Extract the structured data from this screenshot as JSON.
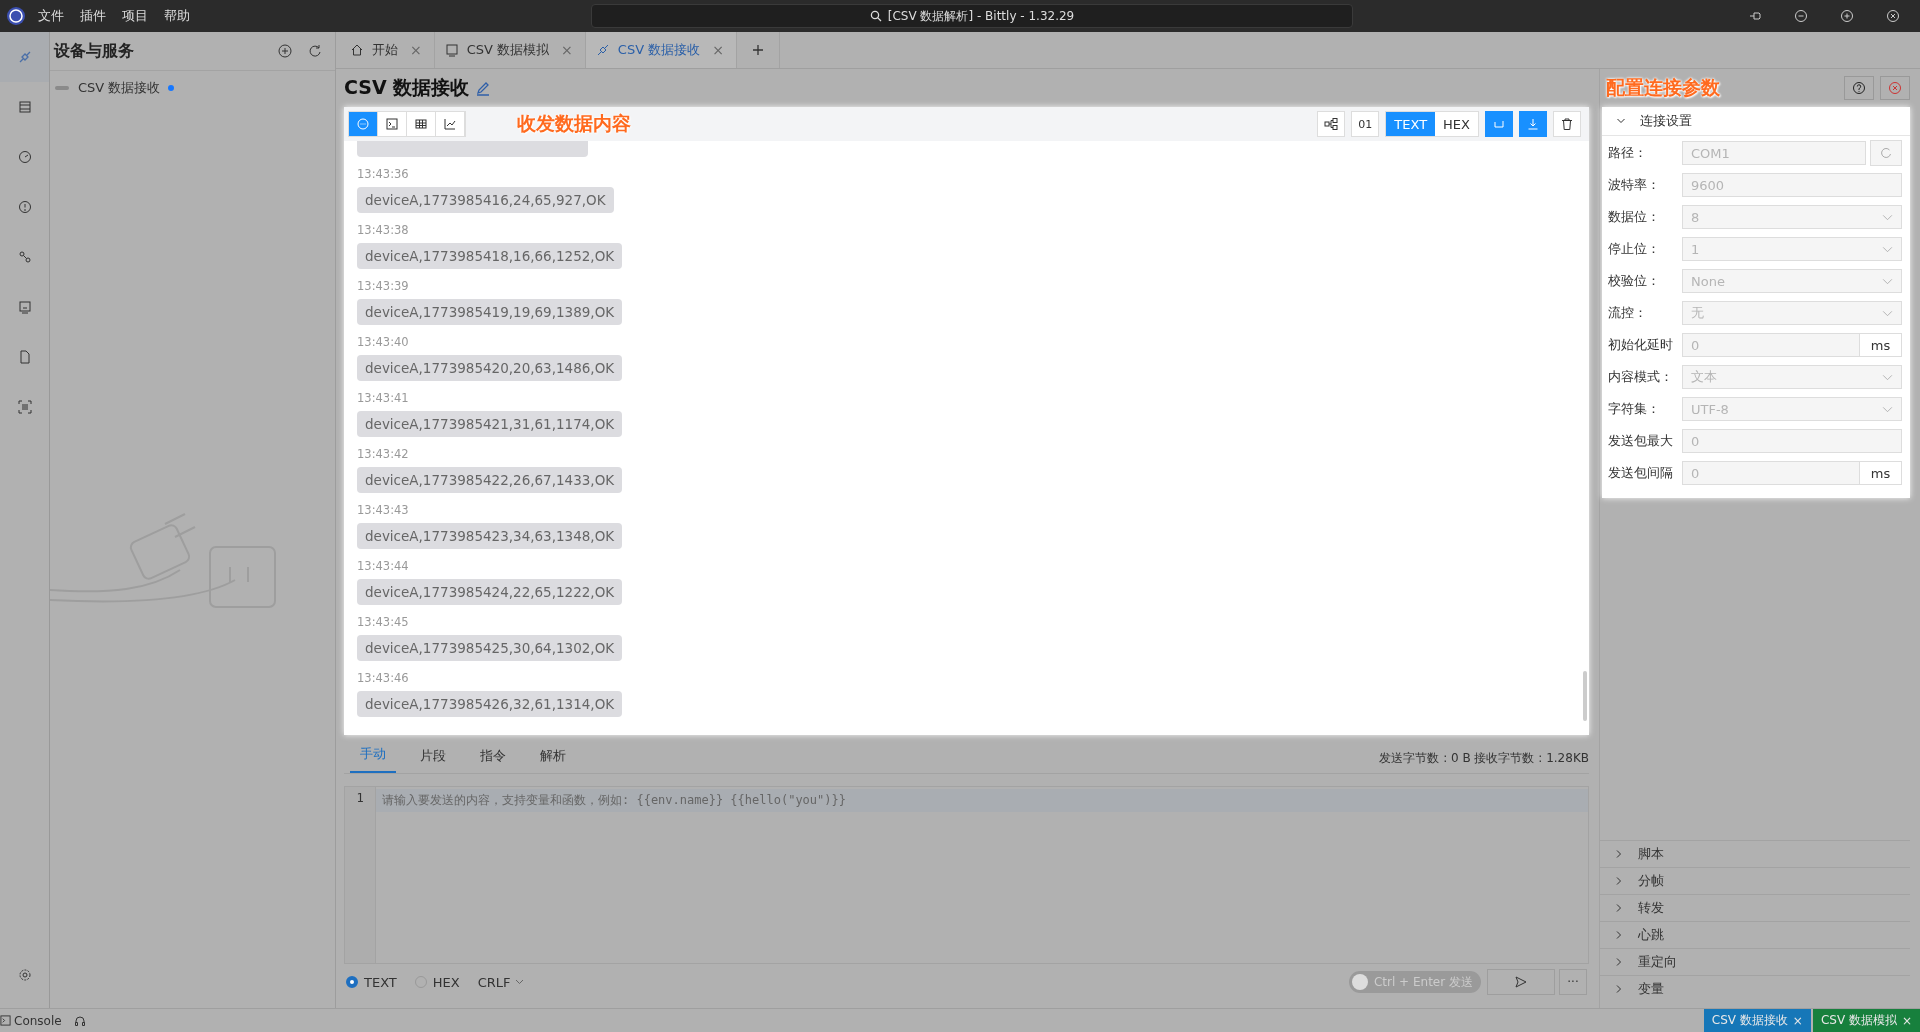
{
  "menu": [
    "文件",
    "插件",
    "项目",
    "帮助"
  ],
  "window": {
    "title": "[CSV 数据解析] - Bittly - 1.32.29"
  },
  "sidebar": {
    "title": "设备与服务",
    "items": [
      {
        "label": "CSV 数据接收",
        "active": true
      }
    ]
  },
  "tabs": [
    {
      "label": "开始",
      "kind": "home",
      "selected": false,
      "close": "×"
    },
    {
      "label": "CSV 数据模拟",
      "kind": "device",
      "selected": false,
      "close": "×"
    },
    {
      "label": "CSV 数据接收",
      "kind": "link",
      "selected": true,
      "close": "×"
    }
  ],
  "page_title": "CSV 数据接收",
  "annotations": [
    "收发数据内容",
    "配置连接参数"
  ],
  "view_buttons": [
    {
      "kind": "chat",
      "selected": true
    },
    {
      "kind": "terminal",
      "selected": false
    },
    {
      "kind": "table",
      "selected": false
    },
    {
      "kind": "chart",
      "selected": false
    }
  ],
  "toolbar": {
    "binary_label": "01",
    "modes": [
      {
        "label": "TEXT",
        "selected": true
      },
      {
        "label": "HEX",
        "selected": false
      }
    ],
    "wrap_on": true,
    "autoscroll_on": true
  },
  "messages": [
    {
      "time": "13:43:36",
      "text": "deviceA,1773985416,24,65,927,OK"
    },
    {
      "time": "13:43:38",
      "text": "deviceA,1773985418,16,66,1252,OK"
    },
    {
      "time": "13:43:39",
      "text": "deviceA,1773985419,19,69,1389,OK"
    },
    {
      "time": "13:43:40",
      "text": "deviceA,1773985420,20,63,1486,OK"
    },
    {
      "time": "13:43:41",
      "text": "deviceA,1773985421,31,61,1174,OK"
    },
    {
      "time": "13:43:42",
      "text": "deviceA,1773985422,26,67,1433,OK"
    },
    {
      "time": "13:43:43",
      "text": "deviceA,1773985423,34,63,1348,OK"
    },
    {
      "time": "13:43:44",
      "text": "deviceA,1773985424,22,65,1222,OK"
    },
    {
      "time": "13:43:45",
      "text": "deviceA,1773985425,30,64,1302,OK"
    },
    {
      "time": "13:43:46",
      "text": "deviceA,1773985426,32,61,1314,OK"
    }
  ],
  "send_tabs": [
    {
      "label": "手动",
      "selected": true
    },
    {
      "label": "片段",
      "selected": false
    },
    {
      "label": "指令",
      "selected": false
    },
    {
      "label": "解析",
      "selected": false
    }
  ],
  "byte_counts": "发送字节数 : 0 B 接收字节数 : 1.28KB",
  "editor": {
    "line_number": "1",
    "placeholder": "请输入要发送的内容，支持变量和函数，例如:  {{env.name}} {{hello(\"you\")}}"
  },
  "send_formats": [
    {
      "label": "TEXT",
      "selected": true
    },
    {
      "label": "HEX",
      "selected": false
    }
  ],
  "line_ending": "CRLF",
  "more_label": "···",
  "send_toggle": {
    "label": "Ctrl + Enter 发送",
    "on": false
  },
  "connection": {
    "title": "连接设置",
    "expanded": true,
    "fields": [
      {
        "label": "路径：",
        "value": "COM1",
        "kind": "refresh"
      },
      {
        "label": "波特率：",
        "value": "9600",
        "kind": "input"
      },
      {
        "label": "数据位：",
        "value": "8",
        "kind": "select"
      },
      {
        "label": "停止位：",
        "value": "1",
        "kind": "select"
      },
      {
        "label": "校验位：",
        "value": "None",
        "kind": "select"
      },
      {
        "label": "流控：",
        "value": "无",
        "kind": "select"
      },
      {
        "label": "初始化延时",
        "value": "0",
        "kind": "unit",
        "unit": "ms"
      },
      {
        "label": "内容模式：",
        "value": "文本",
        "kind": "select"
      },
      {
        "label": "字符集：",
        "value": "UTF-8",
        "kind": "select"
      },
      {
        "label": "发送包最大",
        "value": "0",
        "kind": "input"
      },
      {
        "label": "发送包间隔",
        "value": "0",
        "kind": "unit",
        "unit": "ms"
      }
    ]
  },
  "sections": [
    {
      "label": "脚本",
      "expanded": false
    },
    {
      "label": "分帧",
      "expanded": false
    },
    {
      "label": "转发",
      "expanded": false
    },
    {
      "label": "心跳",
      "expanded": false
    },
    {
      "label": "重定向",
      "expanded": false
    },
    {
      "label": "变量",
      "expanded": false
    }
  ],
  "status_bar": {
    "console": "Console",
    "open_tabs": [
      {
        "label": "CSV 数据接收",
        "color": "#1677b8",
        "close": "×"
      },
      {
        "label": "CSV 数据模拟",
        "color": "#17803d",
        "close": "×"
      }
    ]
  }
}
